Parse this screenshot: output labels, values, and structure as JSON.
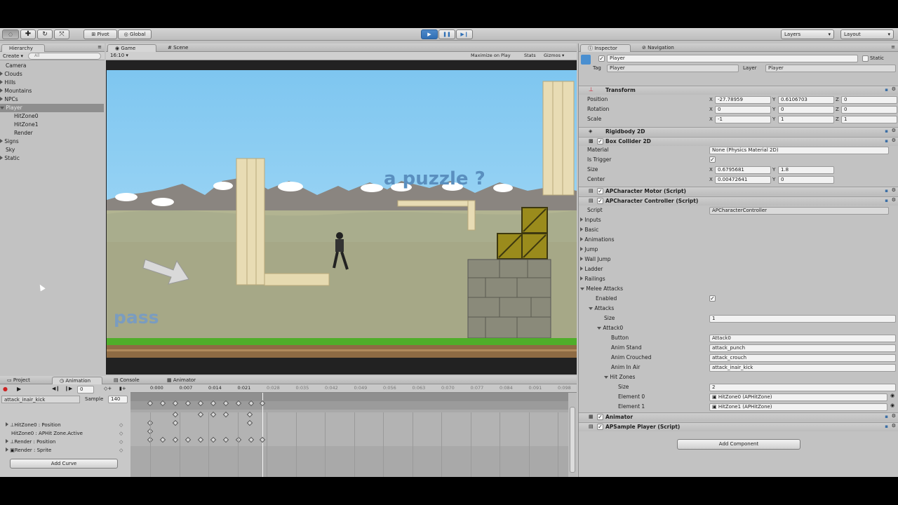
{
  "toolbar": {
    "pivot_label": "Pivot",
    "global_label": "Global",
    "layers_label": "Layers",
    "layout_label": "Layout"
  },
  "hierarchy": {
    "tab_label": "Hierarchy",
    "create_label": "Create",
    "search_placeholder": "All",
    "items": [
      "Camera",
      "Clouds",
      "Hills",
      "Mountains",
      "NPCs",
      "Player",
      "HitZone0",
      "HitZone1",
      "Render",
      "Signs",
      "Sky",
      "Static"
    ]
  },
  "game": {
    "tab_game": "Game",
    "tab_scene": "Scene",
    "aspect": "16:10",
    "maximize_label": "Maximize on Play",
    "stats_label": "Stats",
    "gizmos_label": "Gizmos",
    "puzzle_text": "a puzzle ?",
    "pass_text": "pass",
    "colors": {
      "sky_top": "#7ec6f0",
      "sky_bottom": "#b2e0f8",
      "mountain": "#8a8580",
      "ground": "#a9ad8d",
      "grass": "#4fae2a",
      "dirt": "#8e6b44"
    }
  },
  "animation": {
    "tab_project": "Project",
    "tab_animation": "Animation",
    "tab_console": "Console",
    "tab_animator": "Animator",
    "frame_value": "0",
    "clip_name": "attack_inair_kick",
    "sample_label": "Sample",
    "sample_value": "140",
    "times": [
      "0:000",
      "0:007",
      "0:014",
      "0:021",
      "0:028",
      "0:035",
      "0:042",
      "0:049",
      "0:056",
      "0:063",
      "0:070",
      "0:077",
      "0:084",
      "0:091",
      "0:098"
    ],
    "properties": [
      "HitZone0 : Position",
      "HitZone0 : APHit Zone.Active",
      "Render : Position",
      "Render : Sprite"
    ],
    "add_curve_label": "Add Curve"
  },
  "inspector": {
    "tab_inspector": "Inspector",
    "tab_navigation": "Navigation",
    "object_name": "Player",
    "static_label": "Static",
    "tag_label": "Tag",
    "tag_value": "Player",
    "layer_label": "Layer",
    "layer_value": "Player",
    "transform": {
      "title": "Transform",
      "position_label": "Position",
      "position": [
        "-27.78959",
        "0.6106703",
        "0"
      ],
      "rotation_label": "Rotation",
      "rotation": [
        "0",
        "0",
        "0"
      ],
      "scale_label": "Scale",
      "scale": [
        "-1",
        "1",
        "1"
      ]
    },
    "rigidbody_title": "Rigidbody 2D",
    "box_collider": {
      "title": "Box Collider 2D",
      "material_label": "Material",
      "material_value": "None (Physics Material 2D)",
      "trigger_label": "Is Trigger",
      "size_label": "Size",
      "size": [
        "0.6795681",
        "1.8"
      ],
      "center_label": "Center",
      "center": [
        "0.00472641",
        "0"
      ]
    },
    "motor_title": "APCharacter Motor (Script)",
    "controller": {
      "title": "APCharacter Controller (Script)",
      "script_label": "Script",
      "script_value": "APCharacterController",
      "groups": [
        "Inputs",
        "Basic",
        "Animations",
        "Jump",
        "Wall Jump",
        "Ladder",
        "Railings"
      ],
      "melee_label": "Melee Attacks",
      "enabled_label": "Enabled",
      "attacks_label": "Attacks",
      "size_label": "Size",
      "size_value": "1",
      "attack0_label": "Attack0",
      "button_label": "Button",
      "button_value": "Attack0",
      "anim_stand_label": "Anim Stand",
      "anim_stand_value": "attack_punch",
      "anim_crouched_label": "Anim Crouched",
      "anim_crouched_value": "attack_crouch",
      "anim_inair_label": "Anim In Air",
      "anim_inair_value": "attack_inair_kick",
      "hitzones_label": "Hit Zones",
      "hz_size_label": "Size",
      "hz_size_value": "2",
      "element0_label": "Element 0",
      "element0_value": "HitZone0 (APHitZone)",
      "element1_label": "Element 1",
      "element1_value": "HitZone1 (APHitZone)"
    },
    "animator_title": "Animator",
    "sample_player_title": "APSample Player (Script)",
    "add_component_label": "Add Component"
  }
}
